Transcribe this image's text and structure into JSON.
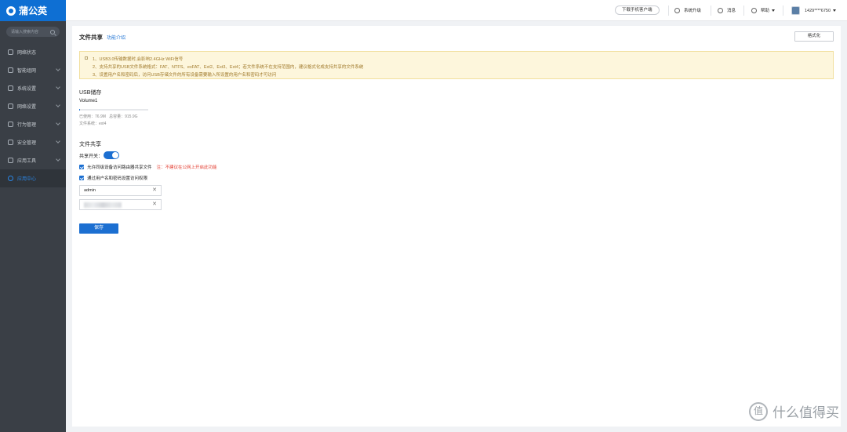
{
  "app": {
    "logo_text": "蒲公英"
  },
  "sidebar": {
    "search_placeholder": "请输入搜索内容",
    "items": [
      {
        "label": "网络状态",
        "icon": "network-status-icon"
      },
      {
        "label": "智能组网",
        "icon": "smart-network-icon"
      },
      {
        "label": "系统设置",
        "icon": "system-settings-icon"
      },
      {
        "label": "网络设置",
        "icon": "network-settings-icon"
      },
      {
        "label": "行为管理",
        "icon": "behavior-icon"
      },
      {
        "label": "安全管理",
        "icon": "security-icon"
      },
      {
        "label": "应用工具",
        "icon": "tools-icon"
      },
      {
        "label": "应用中心",
        "icon": "app-center-icon"
      }
    ]
  },
  "header": {
    "download_client": "下载手机客户端",
    "upgrade": "系统升级",
    "messages": "消息",
    "help": "帮助",
    "user": "1429****6750"
  },
  "page": {
    "title": "文件共享",
    "intro_link": "功能介绍",
    "format_button": "格式化",
    "notice": [
      "1、USB3.0传输数据时,会影响2.4GHz WiFi信号",
      "2、支持共享的USB文件系统格式：FAT、NTFS、exFAT、Ext2、Ext3、Ext4；若文件系统不在支持范围内，建议格式化成支持共享的文件系统",
      "3、设置用户名和密码后，访问USB存储文件的所有设备需要输入所设置的用户名和密码才可访问"
    ],
    "usb": {
      "section_title": "USB储存",
      "volume": "Volume1",
      "used": "已使用：",
      "used_value": "76.9M",
      "total": "总容量：",
      "total_value": "915.9G",
      "fs_label": "文件系统：",
      "fs_value": "ext4",
      "used_fraction": 0.0001
    },
    "share": {
      "section_title": "文件共享",
      "switch_label": "共享开关：",
      "allow_lan": "允许同级设备访问路由器共享文件",
      "warning": "注：不建议在公网上开启此功能",
      "use_credentials": "通过用户名和密码设置访问权限",
      "username": "admin",
      "save": "保存"
    }
  },
  "watermark": {
    "text": "什么值得买",
    "icon_char": "值"
  }
}
